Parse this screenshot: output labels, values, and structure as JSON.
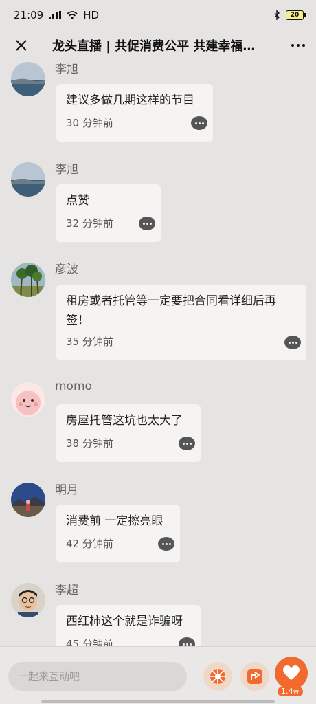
{
  "status_bar": {
    "time": "21:09",
    "network": "HD",
    "battery": "20"
  },
  "header": {
    "title": "龙头直播 | 共促消费公平 共建幸福…"
  },
  "comments": [
    {
      "name": "李旭",
      "text": "建议多做几期这样的节目",
      "time": "30 分钟前",
      "avatar": "lake-landscape"
    },
    {
      "name": "李旭",
      "text": "点赞",
      "time": "32 分钟前",
      "avatar": "lake-landscape"
    },
    {
      "name": "彦波",
      "text": "租房或者托管等一定要把合同看详细后再签！",
      "time": "35 分钟前",
      "avatar": "palm-trees"
    },
    {
      "name": "momo",
      "text": "房屋托管这坑也太大了",
      "time": "38 分钟前",
      "avatar": "pink-cartoon"
    },
    {
      "name": "明月",
      "text": "消费前 一定擦亮眼",
      "time": "42 分钟前",
      "avatar": "mountain-person"
    },
    {
      "name": "李超",
      "text": "西红柿这个就是诈骗呀",
      "time": "45 分钟前",
      "avatar": "man-glasses"
    }
  ],
  "bottom_bar": {
    "input_placeholder": "一起来互动吧",
    "like_count": "1.4w"
  },
  "colors": {
    "accent": "#f26a2e",
    "background": "#e6e4e2",
    "bubble": "#f5f4f2"
  },
  "icons": [
    "close-icon",
    "more-icon",
    "reply-icon",
    "wheel-icon",
    "share-icon",
    "heart-icon"
  ]
}
